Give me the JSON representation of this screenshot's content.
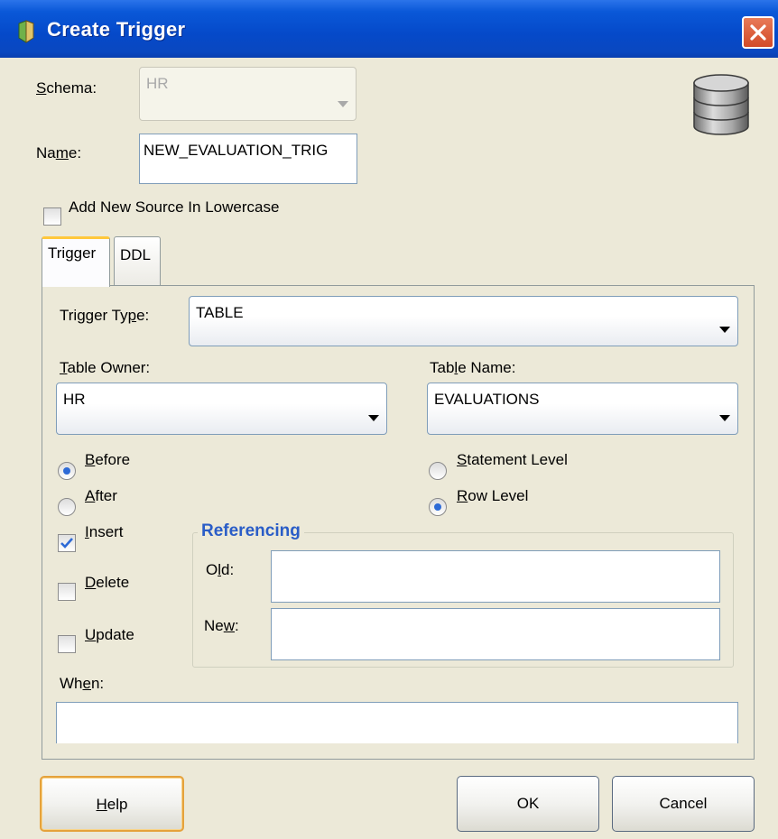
{
  "window": {
    "title": "Create Trigger"
  },
  "schema": {
    "label": "Schema:",
    "value": "HR"
  },
  "name": {
    "label": "Name:",
    "value": "NEW_EVALUATION_TRIG"
  },
  "lowercase_checkbox": {
    "label": "Add New Source In Lowercase",
    "checked": false
  },
  "tabs": [
    {
      "label": "Trigger",
      "selected": true
    },
    {
      "label": "DDL",
      "selected": false
    }
  ],
  "trigger_type": {
    "label": "Trigger Type:",
    "value": "TABLE"
  },
  "table_owner": {
    "label": "Table Owner:",
    "value": "HR"
  },
  "table_name": {
    "label": "Table Name:",
    "value": "EVALUATIONS"
  },
  "timing": {
    "before_label": "Before",
    "after_label": "After",
    "selected": "Before"
  },
  "level": {
    "statement_label": "Statement Level",
    "row_label": "Row Level",
    "selected": "Row Level"
  },
  "events": {
    "insert_label": "Insert",
    "insert_checked": true,
    "delete_label": "Delete",
    "delete_checked": false,
    "update_label": "Update",
    "update_checked": false
  },
  "referencing": {
    "title": "Referencing",
    "old_label": "Old:",
    "old_value": "",
    "new_label": "New:",
    "new_value": ""
  },
  "when": {
    "label": "When:",
    "value": ""
  },
  "buttons": {
    "help": "Help",
    "ok": "OK",
    "cancel": "Cancel"
  },
  "colors": {
    "titlebar": "#0a58d8",
    "dialog_bg": "#ece9d8",
    "group_title": "#2a5dc7",
    "default_button_border": "#e5a23c"
  }
}
